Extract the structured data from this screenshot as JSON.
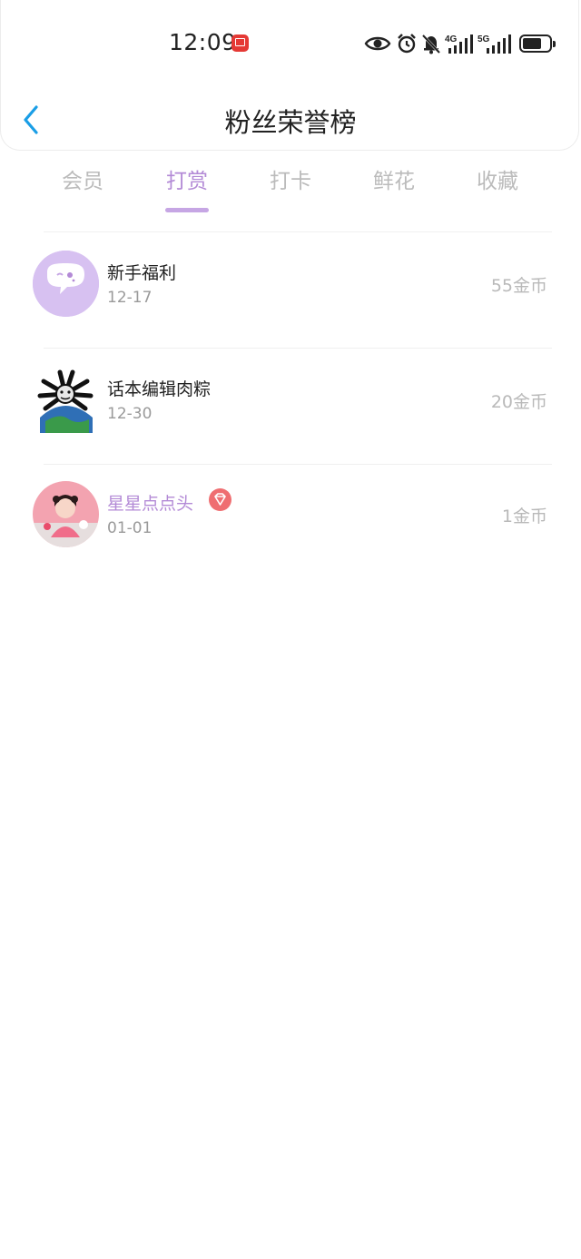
{
  "status_bar": {
    "time": "12:09",
    "net1": "4G",
    "net2": "5G"
  },
  "header": {
    "title": "粉丝荣誉榜"
  },
  "tabs": [
    {
      "label": "会员",
      "active": false
    },
    {
      "label": "打赏",
      "active": true
    },
    {
      "label": "打卡",
      "active": false
    },
    {
      "label": "鲜花",
      "active": false
    },
    {
      "label": "收藏",
      "active": false
    }
  ],
  "list": [
    {
      "name": "新手福利",
      "date": "12-17",
      "coins": "55金币",
      "avatar_icon": "chat-bubble-icon",
      "vip": false
    },
    {
      "name": "话本编辑肉粽",
      "date": "12-30",
      "coins": "20金币",
      "avatar_icon": "meme-avatar",
      "vip": false
    },
    {
      "name": "星星点点头",
      "date": "01-01",
      "coins": "1金币",
      "avatar_icon": "girl-photo-avatar",
      "vip": true
    }
  ],
  "colors": {
    "accent": "#b38ad6",
    "back_arrow": "#1a9ee6",
    "vip_badge": "#ef6e71"
  }
}
